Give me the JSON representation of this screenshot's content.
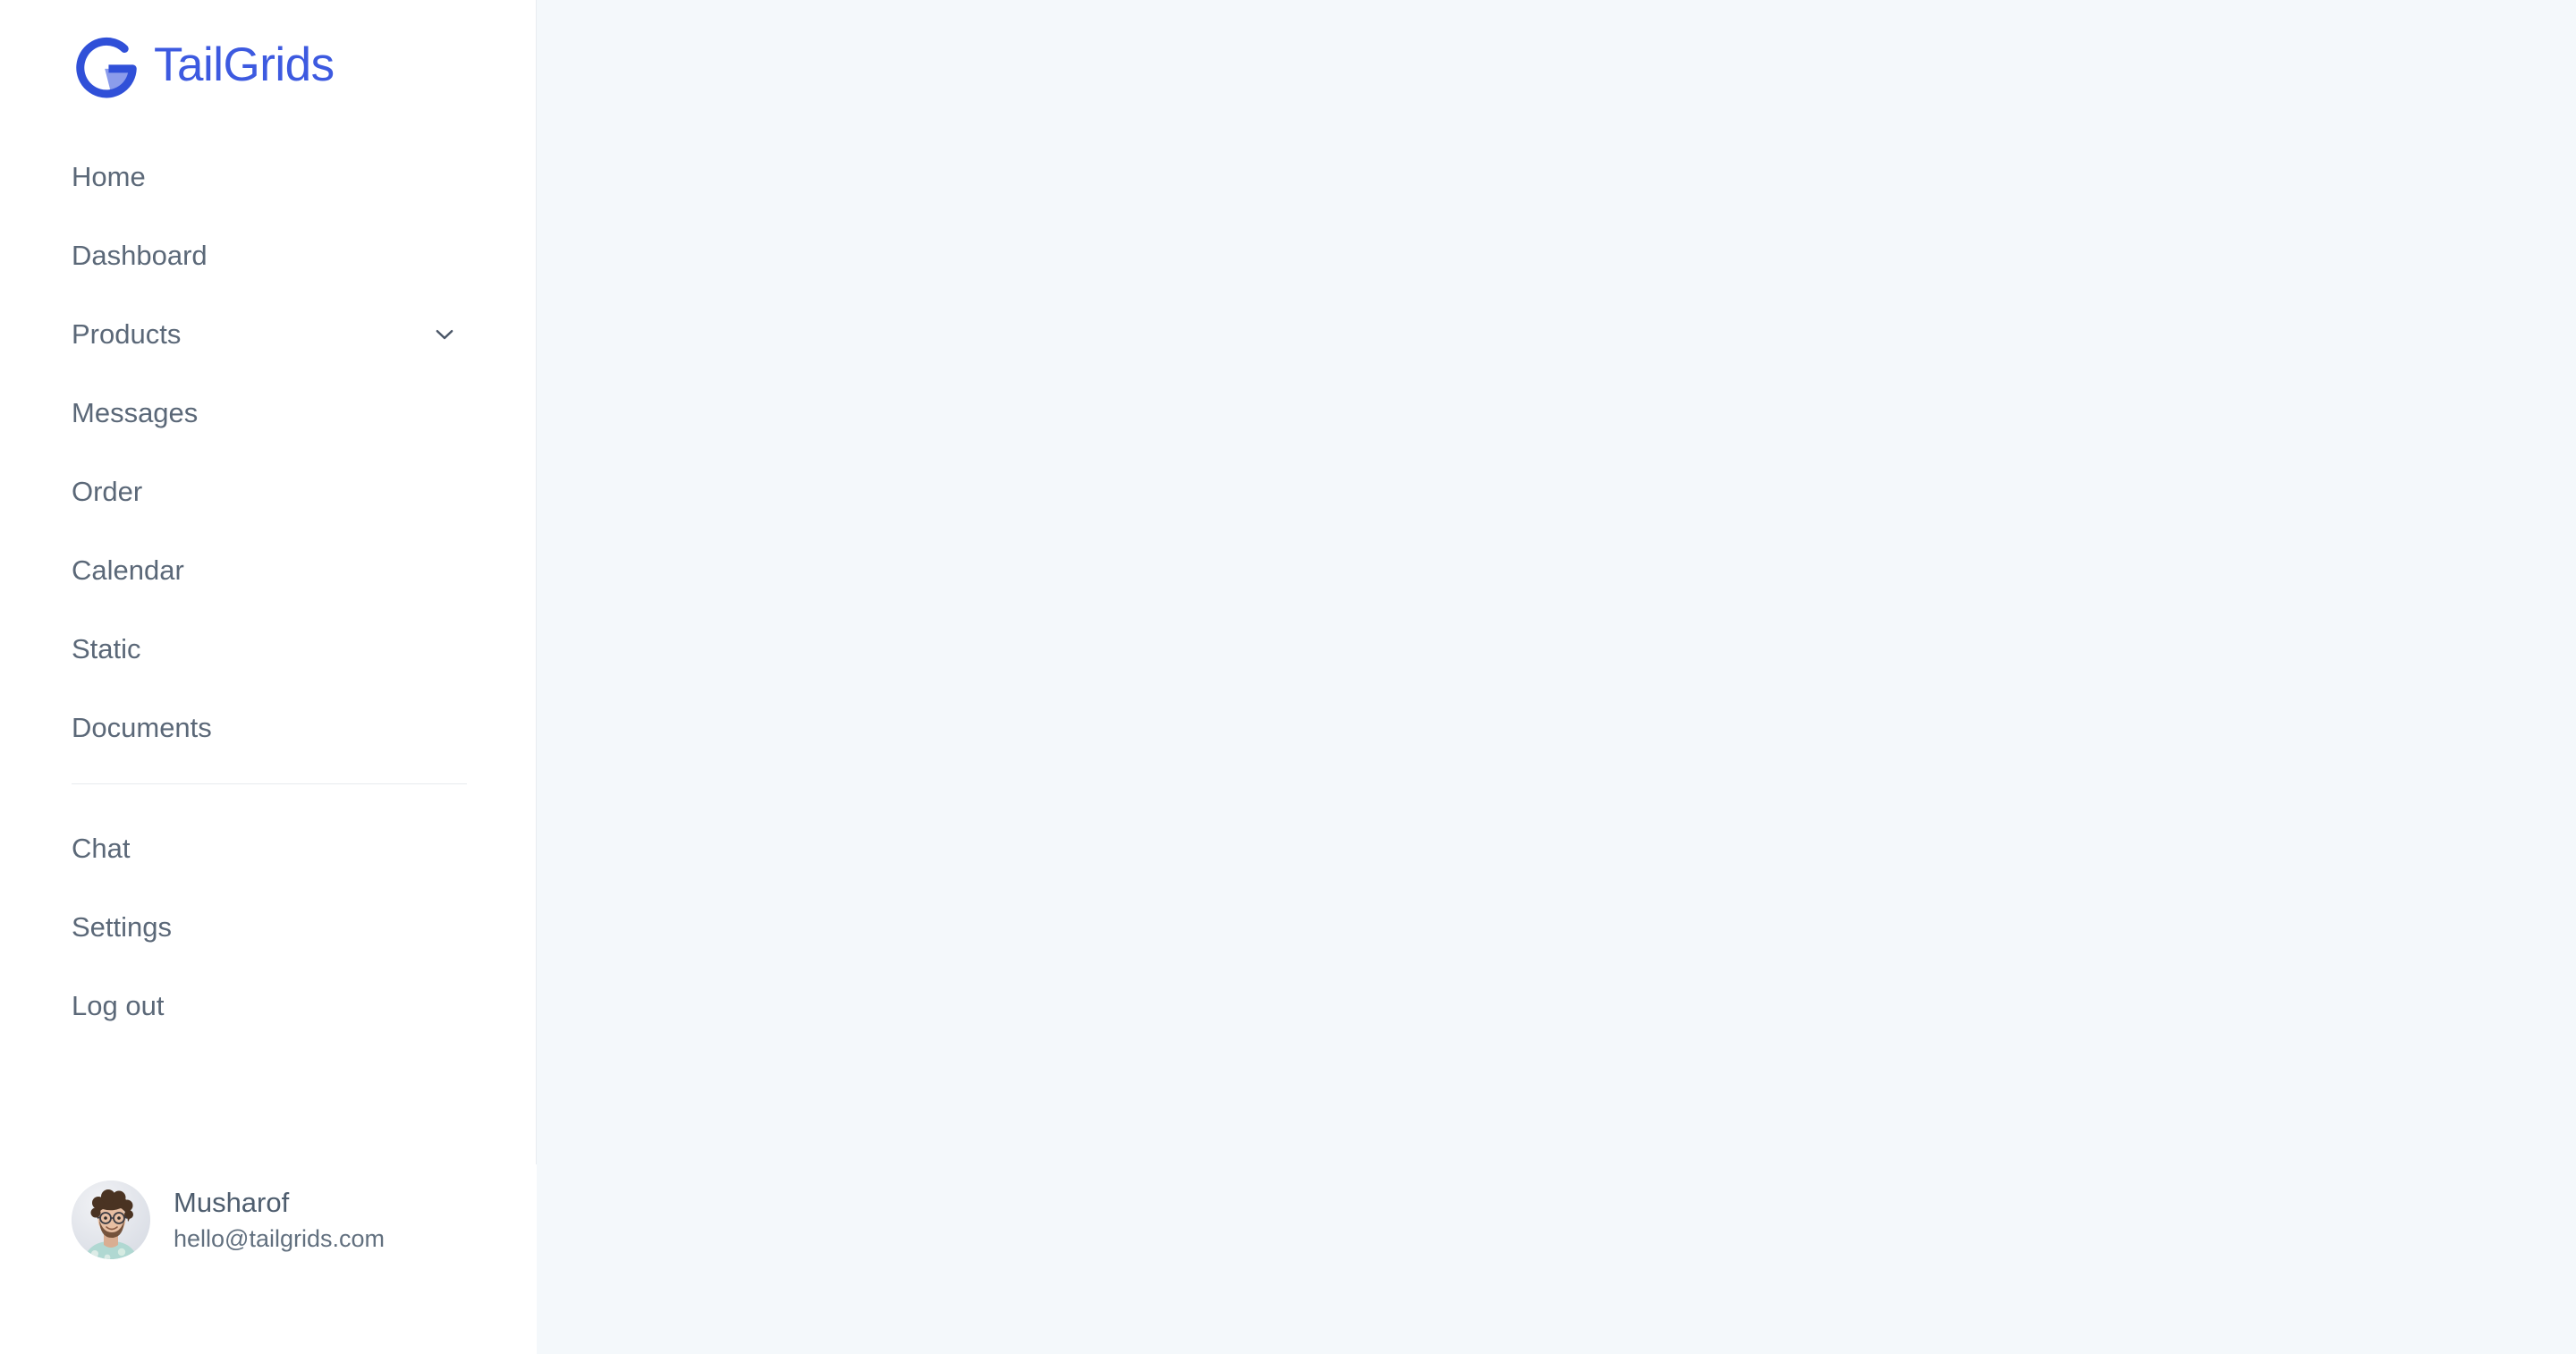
{
  "brand": {
    "name": "TailGrids",
    "logo_icon": "tailgrids-g-logo-icon",
    "logo_color_dark": "#3d5ae0",
    "logo_color_light": "#8b9ceb",
    "wordmark_color": "#3d5ae0"
  },
  "sidebar": {
    "background": "#ffffff",
    "border_color": "#e8ecf1",
    "text_color": "#5b6878",
    "divider_color": "#e7eaee",
    "primary_items": [
      {
        "label": "Home",
        "name": "home",
        "has_chevron": false
      },
      {
        "label": "Dashboard",
        "name": "dashboard",
        "has_chevron": false
      },
      {
        "label": "Products",
        "name": "products",
        "has_chevron": true,
        "chevron_icon": "chevron-down-icon"
      },
      {
        "label": "Messages",
        "name": "messages",
        "has_chevron": false
      },
      {
        "label": "Order",
        "name": "order",
        "has_chevron": false
      },
      {
        "label": "Calendar",
        "name": "calendar",
        "has_chevron": false
      },
      {
        "label": "Static",
        "name": "static",
        "has_chevron": false
      },
      {
        "label": "Documents",
        "name": "documents",
        "has_chevron": false
      }
    ],
    "secondary_items": [
      {
        "label": "Chat",
        "name": "chat"
      },
      {
        "label": "Settings",
        "name": "settings"
      },
      {
        "label": "Log out",
        "name": "logout"
      }
    ],
    "profile": {
      "name": "Musharof",
      "email": "hello@tailgrids.com",
      "avatar_icon": "user-avatar-photo"
    }
  },
  "main": {
    "background": "#f4f8fb",
    "content": ""
  }
}
